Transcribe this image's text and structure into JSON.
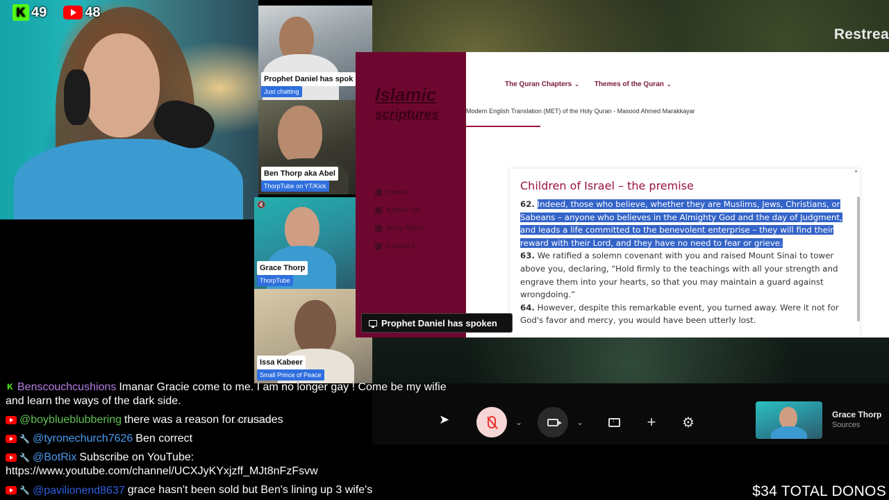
{
  "viewers": {
    "kick_count": "49",
    "youtube_count": "48"
  },
  "backdrop": {
    "restream_label": "Restrea"
  },
  "participants": [
    {
      "name": "Prophet Daniel has spok",
      "tag": "Just chatting"
    },
    {
      "name": "Ben Thorp aka Abel",
      "tag": "ThorpTube on YT/Kick"
    },
    {
      "name": "Grace Thorp",
      "tag": "ThorpTube"
    },
    {
      "name": "Issa Kabeer",
      "tag": "Small Prince of Peace"
    }
  ],
  "website": {
    "logo_line1": "Islamic",
    "logo_line2": "scriptures",
    "sidebar_items": [
      "Home",
      "About Us",
      "Holy Bible",
      "Contact"
    ],
    "nav": [
      "The Quran Chapters",
      "Themes of the Quran"
    ],
    "subtitle": "Modern English Translation (MET) of the Holy Quran - Masood Ahmed Marakkayar",
    "heading": "Children of Israel – the premise",
    "verses": [
      {
        "num": "62.",
        "text": "Indeed, those who believe, whether they are Muslims, Jews, Christians, or Sabeans – anyone who believes in the Almighty God and the day of Judgment, and leads a life committed to the benevolent enterprise – they will find their reward with their Lord, and they have no need to fear or grieve."
      },
      {
        "num": "63.",
        "text": "We ratified a solemn covenant with you and raised Mount Sinai to tower above you, declaring, “Hold firmly to the teachings with all your strength and engrave them into your hearts, so that you may maintain a guard against wrongdoing.”"
      },
      {
        "num": "64.",
        "text": "However, despite this remarkable event, you turned away. Were it not for God's favor and mercy, you would have been utterly lost."
      }
    ]
  },
  "banner": {
    "text": "Prophet Daniel has spoken"
  },
  "controls": {
    "mic_state": "muted",
    "self_name": "Grace Thorp",
    "self_sub": "Sources"
  },
  "chat": [
    {
      "platform": "kick",
      "user": "Benscouchcushions",
      "user_color": "purple",
      "mod": false,
      "text": "Imanar Gracie come to me. I am no longer gay ! Come be my wifie and learn the ways of the dark side."
    },
    {
      "platform": "youtube",
      "user": "@boyblueblubbering",
      "user_color": "green",
      "mod": false,
      "text": "there was a reason for crusades"
    },
    {
      "platform": "youtube",
      "user": "@tyronechurch7626",
      "user_color": "blue",
      "mod": true,
      "text": "Ben correct"
    },
    {
      "platform": "youtube",
      "user": "@BotRix",
      "user_color": "blue",
      "mod": true,
      "text": "Subscribe on YouTube: https://www.youtube.com/channel/UCXJyKYxjzff_MJt8nFzFsvw"
    },
    {
      "platform": "youtube",
      "user": "@pavilionend8637",
      "user_color": "dblue",
      "mod": true,
      "text": "grace hasn't been sold but Ben's lining up 3 wife's"
    }
  ],
  "ghost_text": "Leave Call",
  "donations": "$34 TOTAL DONOS",
  "colors": {
    "site_sidebar": "#6e0730",
    "highlight": "#3464c8",
    "kick_green": "#53fc18",
    "youtube_red": "#ff0000"
  }
}
